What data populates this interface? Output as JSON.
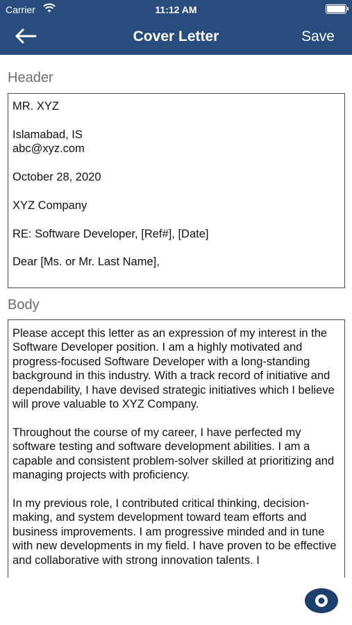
{
  "status_bar": {
    "carrier": "Carrier",
    "time": "11:12 AM"
  },
  "nav": {
    "title": "Cover Letter",
    "save_label": "Save"
  },
  "header_section": {
    "label": "Header",
    "text": "MR. XYZ\n\nIslamabad, IS\nabc@xyz.com\n\nOctober 28, 2020\n\nXYZ Company\n\nRE: Software Developer, [Ref#], [Date]\n\nDear [Ms. or Mr. Last Name],"
  },
  "body_section": {
    "label": "Body",
    "text": "Please accept this letter as an expression of my interest in the Software Developer position. I am a highly motivated and progress-focused Software Developer with a long-standing background in this industry. With a track record of initiative and dependability, I have devised strategic initiatives which I believe will prove valuable to XYZ Company.\n\nThroughout the course of my career, I have perfected my software testing and software development abilities. I am a capable and consistent problem-solver skilled at prioritizing and managing projects with proficiency.\n\nIn my previous role, I contributed critical thinking, decision-making, and system development toward team efforts and business improvements. I am progressive minded and in tune with new developments in my field. I have proven to be effective and collaborative with strong innovation talents. I"
  },
  "colors": {
    "nav_background": "#284c7e",
    "accent": "#1d3f6e"
  },
  "icons": {
    "back": "arrow-left-icon",
    "preview": "eye-icon",
    "wifi": "wifi-icon",
    "battery": "battery-icon"
  }
}
